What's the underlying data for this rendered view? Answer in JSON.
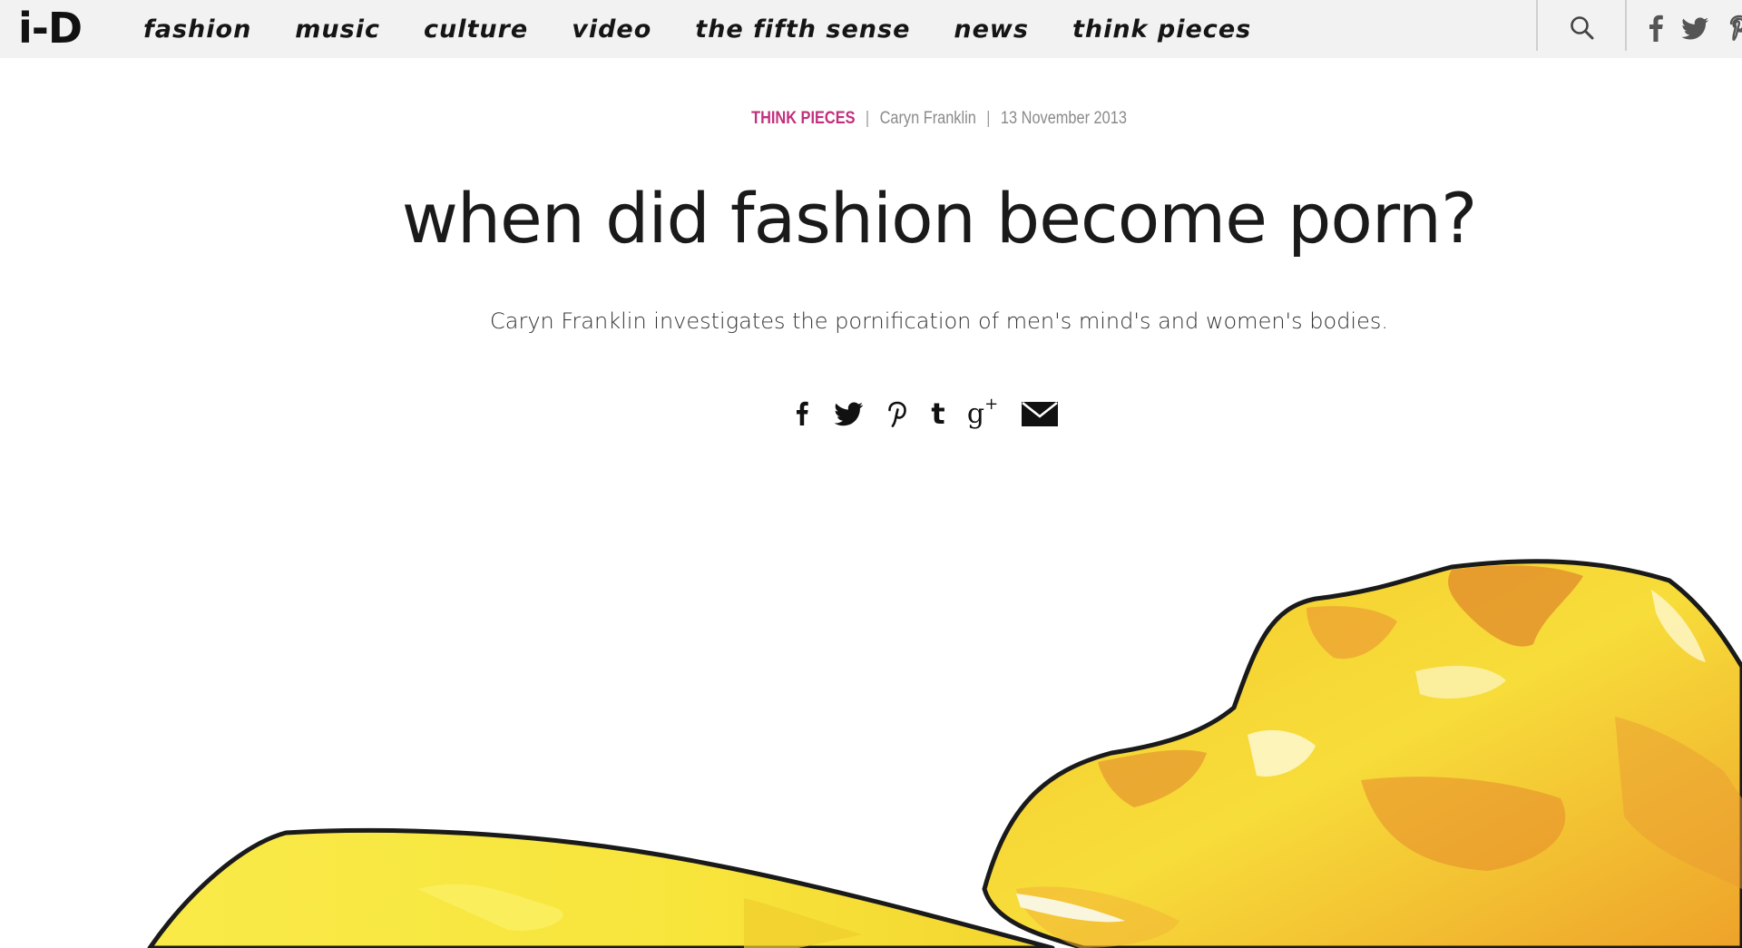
{
  "site": {
    "logo": "i-D"
  },
  "nav": {
    "items": [
      "fashion",
      "music",
      "culture",
      "video",
      "the fifth sense",
      "news",
      "think pieces"
    ]
  },
  "article": {
    "category": "THINK PIECES",
    "author": "Caryn Franklin",
    "date": "13 November 2013",
    "separator": "|",
    "title": "when did fashion become porn?",
    "standfirst": "Caryn Franklin investigates the pornification of men's mind's and women's bodies."
  },
  "share": {
    "icons": [
      "facebook-icon",
      "twitter-icon",
      "pinterest-icon",
      "tumblr-icon",
      "google-plus-icon",
      "email-icon"
    ],
    "facebook_glyph": "f",
    "tumblr_glyph": "t",
    "gplus_glyph": "g",
    "gplus_sup": "+"
  },
  "colors": {
    "category": "#c2307d",
    "nav_bg": "#f2f2f2",
    "text": "#1a1a1a",
    "illustration_yellow": "#f7e23a",
    "illustration_orange": "#e0892a"
  }
}
